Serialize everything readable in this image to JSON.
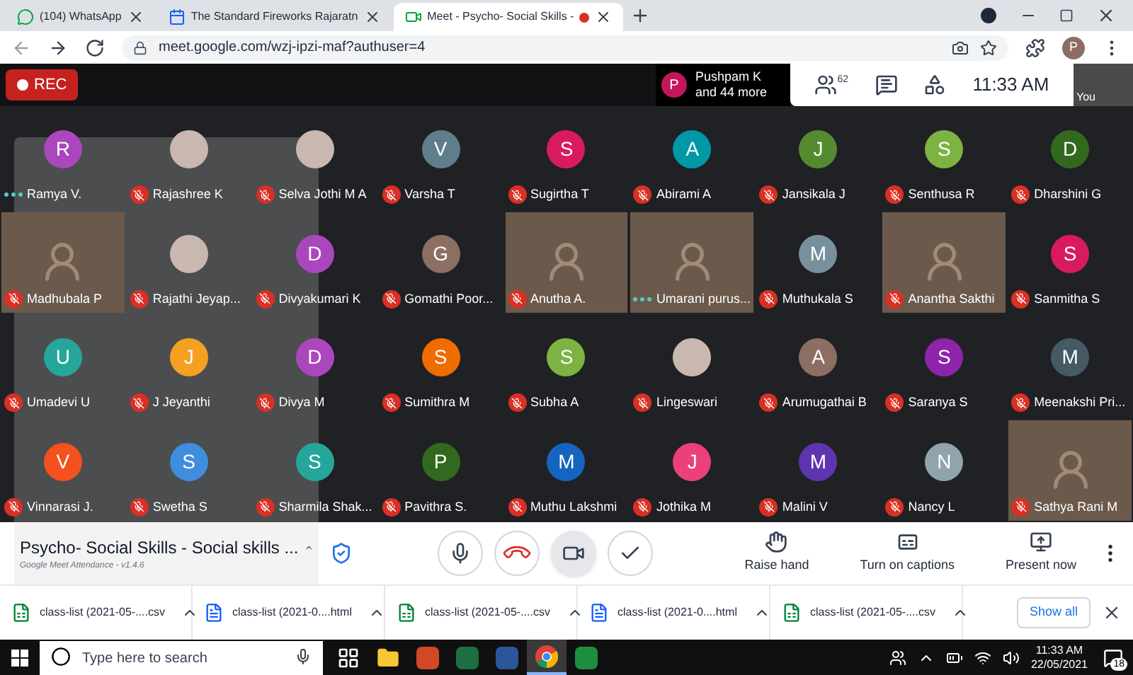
{
  "browser": {
    "tabs": [
      {
        "title": "(104) WhatsApp",
        "kind": "whatsapp",
        "selected": false,
        "recording": false
      },
      {
        "title": "The Standard Fireworks Rajaratn",
        "kind": "calendar",
        "selected": false,
        "recording": false
      },
      {
        "title": "Meet - Psycho- Social Skills -",
        "kind": "meet",
        "selected": true,
        "recording": true
      }
    ],
    "url": "meet.google.com/wzj-ipzi-maf?authuser=4",
    "profile_initial": "P"
  },
  "meet_bar": {
    "rec_label": "REC",
    "presenter": {
      "initial": "P",
      "name": "Pushpam K",
      "more": "and 44 more"
    },
    "participant_count": "62",
    "time": "11:33 AM",
    "self_label": "You"
  },
  "tiles": [
    {
      "name": "Ramya V.",
      "kind": "avatar",
      "initial": "R",
      "color": "#ab47bc",
      "muted": false,
      "speaking": true
    },
    {
      "name": "Rajashree K",
      "kind": "photo",
      "muted": true,
      "speaking": false
    },
    {
      "name": "Selva Jothi M A",
      "kind": "photo",
      "muted": true,
      "speaking": false
    },
    {
      "name": "Varsha T",
      "kind": "avatar",
      "initial": "V",
      "color": "#607d8b",
      "muted": true,
      "speaking": false
    },
    {
      "name": "Sugirtha T",
      "kind": "avatar",
      "initial": "S",
      "color": "#d81b60",
      "muted": true,
      "speaking": false
    },
    {
      "name": "Abirami A",
      "kind": "avatar",
      "initial": "A",
      "color": "#0097a7",
      "muted": true,
      "speaking": false
    },
    {
      "name": "Jansikala J",
      "kind": "avatar",
      "initial": "J",
      "color": "#558b2f",
      "muted": true,
      "speaking": false
    },
    {
      "name": "Senthusa R",
      "kind": "avatar",
      "initial": "S",
      "color": "#7cb342",
      "muted": true,
      "speaking": false
    },
    {
      "name": "Dharshini G",
      "kind": "avatar",
      "initial": "D",
      "color": "#33691e",
      "muted": true,
      "speaking": false
    },
    {
      "name": "Madhubala P",
      "kind": "video",
      "muted": true,
      "speaking": false
    },
    {
      "name": "Rajathi Jeyap...",
      "kind": "photo",
      "muted": true,
      "speaking": false
    },
    {
      "name": "Divyakumari K",
      "kind": "avatar",
      "initial": "D",
      "color": "#ab47bc",
      "muted": true,
      "speaking": false
    },
    {
      "name": "Gomathi Poor...",
      "kind": "avatar",
      "initial": "G",
      "color": "#8d6e63",
      "muted": true,
      "speaking": false
    },
    {
      "name": "Anutha A.",
      "kind": "video",
      "muted": true,
      "speaking": false
    },
    {
      "name": "Umarani purus...",
      "kind": "video",
      "muted": false,
      "speaking": true
    },
    {
      "name": "Muthukala S",
      "kind": "avatar",
      "initial": "M",
      "color": "#78909c",
      "muted": true,
      "speaking": false
    },
    {
      "name": "Anantha Sakthi",
      "kind": "video",
      "muted": true,
      "speaking": false
    },
    {
      "name": "Sanmitha S",
      "kind": "avatar",
      "initial": "S",
      "color": "#d81b60",
      "muted": true,
      "speaking": false
    },
    {
      "name": "Umadevi U",
      "kind": "avatar",
      "initial": "U",
      "color": "#26a69a",
      "muted": true,
      "speaking": false
    },
    {
      "name": "J Jeyanthi",
      "kind": "avatar",
      "initial": "J",
      "color": "#f4a020",
      "muted": true,
      "speaking": false
    },
    {
      "name": "Divya M",
      "kind": "avatar",
      "initial": "D",
      "color": "#ab47bc",
      "muted": true,
      "speaking": false
    },
    {
      "name": "Sumithra M",
      "kind": "avatar",
      "initial": "S",
      "color": "#ef6c00",
      "muted": true,
      "speaking": false
    },
    {
      "name": "Subha A",
      "kind": "avatar",
      "initial": "S",
      "color": "#7cb342",
      "muted": true,
      "speaking": false
    },
    {
      "name": "Lingeswari",
      "kind": "photo",
      "muted": true,
      "speaking": false
    },
    {
      "name": "Arumugathai B",
      "kind": "avatar",
      "initial": "A",
      "color": "#8d6e63",
      "muted": true,
      "speaking": false
    },
    {
      "name": "Saranya S",
      "kind": "avatar",
      "initial": "S",
      "color": "#8e24aa",
      "muted": true,
      "speaking": false
    },
    {
      "name": "Meenakshi Pri...",
      "kind": "avatar",
      "initial": "M",
      "color": "#455a64",
      "muted": true,
      "speaking": false
    },
    {
      "name": "Vinnarasi J.",
      "kind": "avatar",
      "initial": "V",
      "color": "#f4511e",
      "muted": true,
      "speaking": false
    },
    {
      "name": "Swetha S",
      "kind": "avatar",
      "initial": "S",
      "color": "#3f8ede",
      "muted": true,
      "speaking": false
    },
    {
      "name": "Sharmila Shak...",
      "kind": "avatar",
      "initial": "S",
      "color": "#26a69a",
      "muted": true,
      "speaking": false
    },
    {
      "name": "Pavithra S.",
      "kind": "avatar",
      "initial": "P",
      "color": "#33691e",
      "muted": true,
      "speaking": false
    },
    {
      "name": "Muthu Lakshmi",
      "kind": "avatar",
      "initial": "M",
      "color": "#1565c0",
      "muted": true,
      "speaking": false
    },
    {
      "name": "Jothika M",
      "kind": "avatar",
      "initial": "J",
      "color": "#ec407a",
      "muted": true,
      "speaking": false
    },
    {
      "name": "Malini V",
      "kind": "avatar",
      "initial": "M",
      "color": "#5e35b1",
      "muted": true,
      "speaking": false
    },
    {
      "name": "Nancy L",
      "kind": "avatar",
      "initial": "N",
      "color": "#90a4ae",
      "muted": true,
      "speaking": false
    },
    {
      "name": "Sathya Rani M",
      "kind": "video",
      "muted": true,
      "speaking": false
    }
  ],
  "attendance_panel": {
    "title": "Psycho- Social Skills - Social skills ...",
    "caption": "Google Meet Attendance - v1.4.6"
  },
  "controls": {
    "buttons": [
      {
        "kind": "mic"
      },
      {
        "kind": "hang_up"
      },
      {
        "kind": "camera"
      },
      {
        "kind": "check"
      }
    ],
    "actions": [
      {
        "kind": "raise_hand",
        "label": "Raise hand"
      },
      {
        "kind": "captions",
        "label": "Turn on captions"
      },
      {
        "kind": "present",
        "label": "Present now"
      }
    ]
  },
  "downloads": {
    "items": [
      {
        "name": "class-list (2021-05-....csv",
        "kind": "csv"
      },
      {
        "name": "class-list (2021-0....html",
        "kind": "html"
      },
      {
        "name": "class-list (2021-05-....csv",
        "kind": "csv"
      },
      {
        "name": "class-list (2021-0....html",
        "kind": "html"
      },
      {
        "name": "class-list (2021-05-....csv",
        "kind": "csv"
      }
    ],
    "show_all": "Show all"
  },
  "taskbar": {
    "search_placeholder": "Type here to search",
    "apps": [
      {
        "kind": "task_view",
        "selected": false
      },
      {
        "kind": "explorer",
        "selected": false
      },
      {
        "kind": "powerpoint",
        "selected": false
      },
      {
        "kind": "excel",
        "selected": false
      },
      {
        "kind": "word",
        "selected": false
      },
      {
        "kind": "chrome",
        "selected": true
      },
      {
        "kind": "other",
        "selected": false
      }
    ],
    "time": "11:33 AM",
    "date": "22/05/2021",
    "notifications": "18"
  }
}
